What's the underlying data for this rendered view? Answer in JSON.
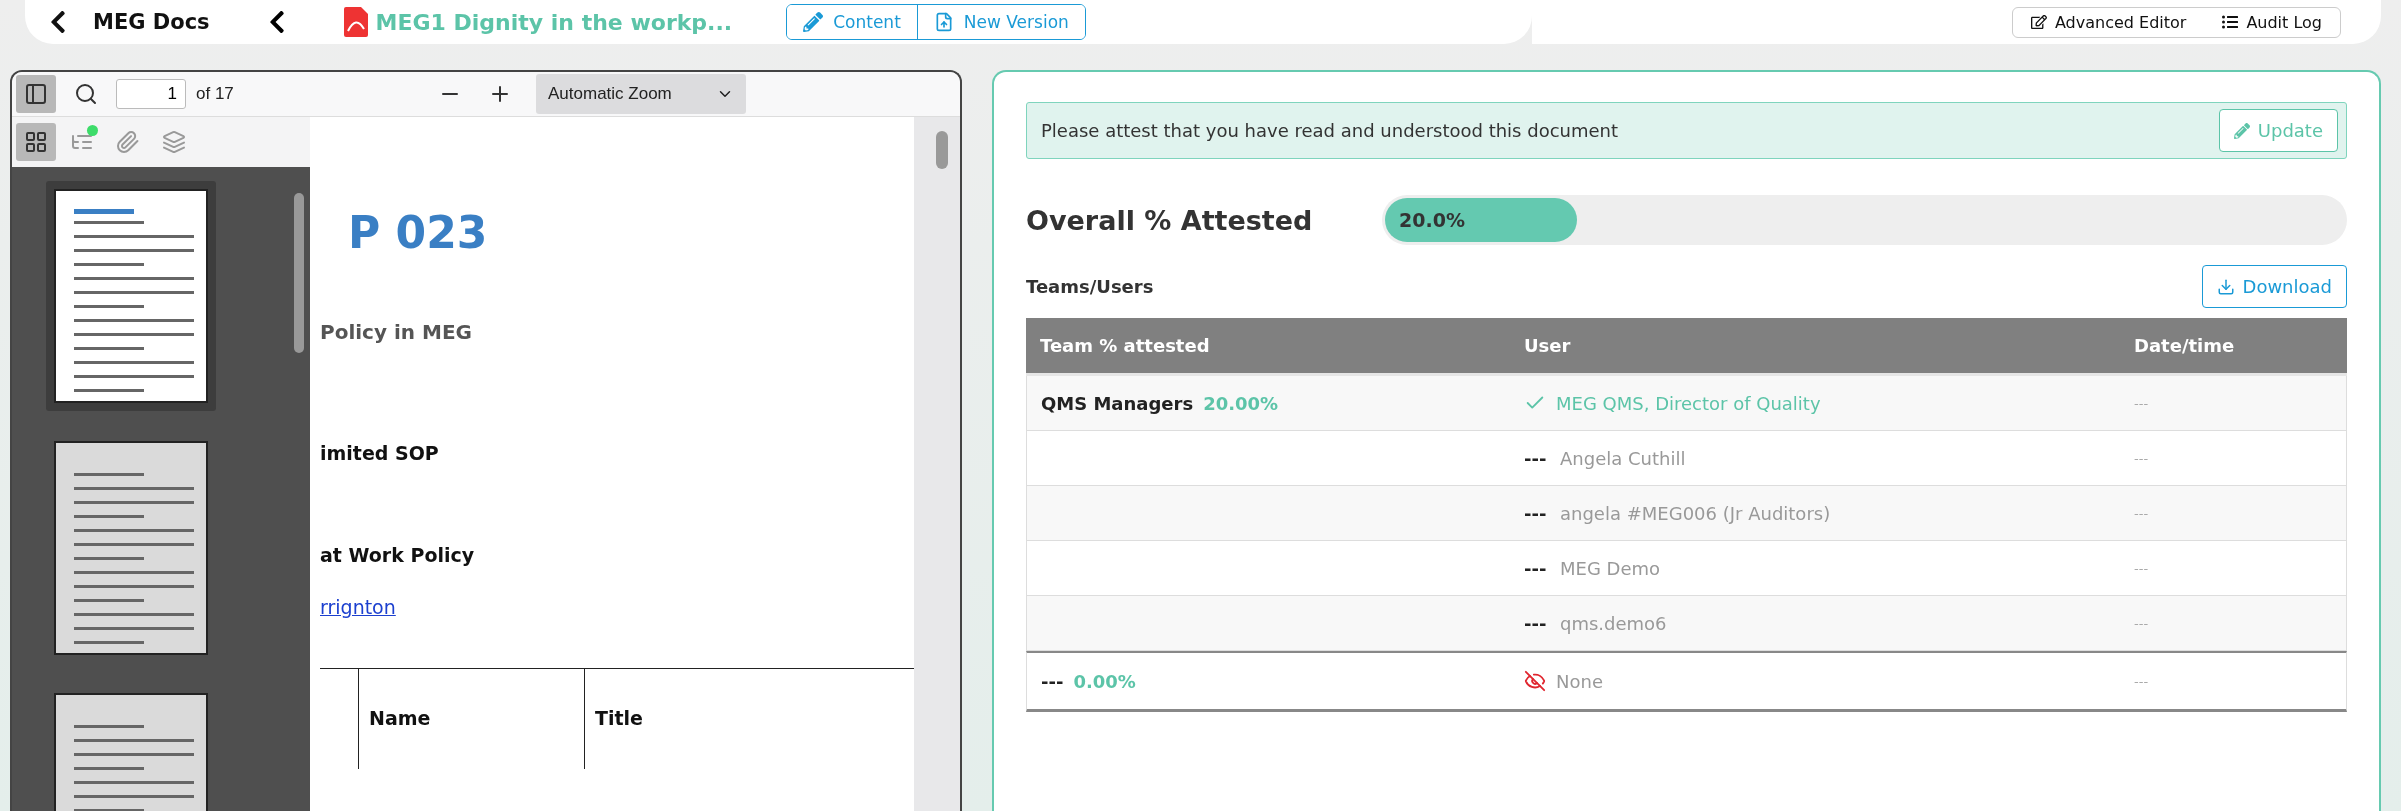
{
  "header": {
    "back_label": "MEG Docs",
    "doc_title": "MEG1 Dignity in the workp...",
    "actions": [
      {
        "label": "Content"
      },
      {
        "label": "New Version"
      }
    ],
    "tools": [
      {
        "label": "Advanced Editor"
      },
      {
        "label": "Audit Log"
      }
    ]
  },
  "viewer": {
    "page": "1",
    "page_count": "of 17",
    "zoom": "Automatic Zoom",
    "sidebar_open": true,
    "sidebar_tabs": [
      {
        "selected": true,
        "badge": false
      },
      {
        "selected": false,
        "badge": true
      },
      {
        "selected": false,
        "badge": false
      },
      {
        "selected": false,
        "badge": false
      }
    ],
    "thumbnails": [
      {
        "selected": true
      },
      {
        "selected": false
      },
      {
        "selected": false
      }
    ],
    "document": [
      {
        "kind": "heading",
        "text": "P 023"
      },
      {
        "kind": "subtitle",
        "text": "Policy in MEG"
      },
      {
        "kind": "bold",
        "text": "imited SOP"
      },
      {
        "kind": "bold",
        "text": "at Work Policy"
      },
      {
        "kind": "link",
        "text": "rrignton"
      }
    ],
    "table_headers": [
      "Name",
      "Title"
    ]
  },
  "attest": {
    "notice": "Please attest that you have read and understood this document",
    "update": "Update",
    "overall_label": "Overall % Attested",
    "overall_reading": "20.0%",
    "level": 0.2,
    "section": "Teams/Users",
    "download": "Download",
    "columns": [
      "Team % attested",
      "User",
      "Date/time"
    ],
    "rows": [
      {
        "team": "QMS Managers",
        "percent": "20.00%",
        "kind": "attested",
        "user": "MEG QMS, Director of Quality",
        "date": "---"
      },
      {
        "kind": "pending",
        "mark": "---",
        "user": "Angela Cuthill",
        "date": "---"
      },
      {
        "kind": "pending",
        "mark": "---",
        "user": "angela #MEG006 (Jr Auditors)",
        "date": "---"
      },
      {
        "kind": "pending",
        "mark": "---",
        "user": "MEG Demo",
        "date": "---"
      },
      {
        "kind": "pending",
        "mark": "---",
        "user": "qms.demo6",
        "date": "---"
      },
      {
        "team": "---",
        "percent": "0.00%",
        "kind": "none",
        "user": "None",
        "date": "---"
      }
    ]
  }
}
